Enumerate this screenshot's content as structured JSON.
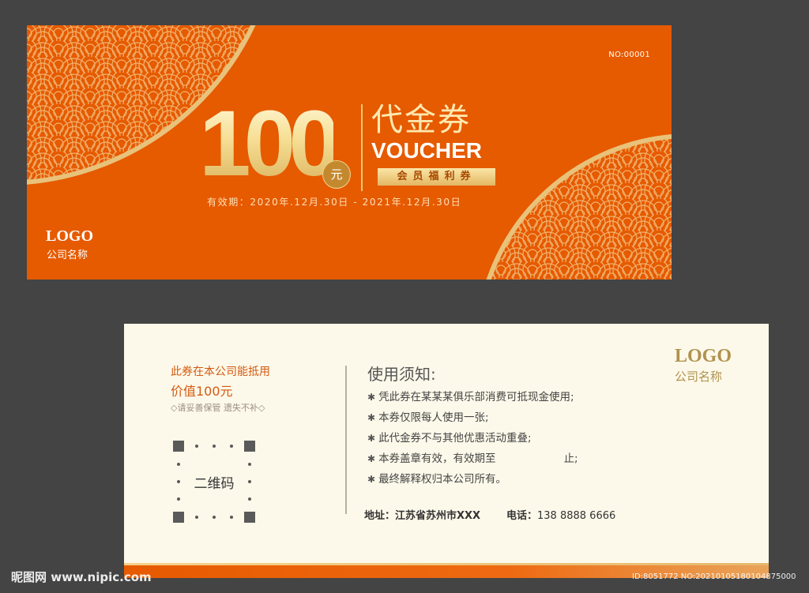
{
  "front": {
    "serial": "NO:00001",
    "amount": "100",
    "currency": "元",
    "title_cn": "代金券",
    "title_en": "VOUCHER",
    "badge": "会员福利券",
    "validity": "有效期：2020年.12月.30日 - 2021年.12月.30日",
    "logo": "LOGO",
    "company": "公司名称"
  },
  "back": {
    "line1": "此券在本公司能抵用",
    "line2": "价值100元",
    "line3": "◇请妥善保管 遗失不补◇",
    "qr_label": "二维码",
    "notice_title": "使用须知:",
    "notice_items": [
      "凭此券在某某某俱乐部消费可抵现金使用;",
      "本券仅限每人使用一张;",
      "此代金券不与其他优惠活动重叠;",
      "本券盖章有效，有效期至",
      "最终解释权归本公司所有。"
    ],
    "notice_item4_suffix": "止;",
    "address_label": "地址：",
    "address_value": "江苏省苏州市XXX",
    "phone_label": "电话：",
    "phone_value": "138 8888 6666",
    "logo": "LOGO",
    "company": "公司名称"
  },
  "watermark": {
    "left": "昵图网 www.nipic.com",
    "right": "ID:8051772 NO:20210105180104875000"
  },
  "colors": {
    "front_bg": "#e65a00",
    "gold": "#f0c874",
    "cream": "#fdf9ea",
    "page_bg": "#444444"
  }
}
